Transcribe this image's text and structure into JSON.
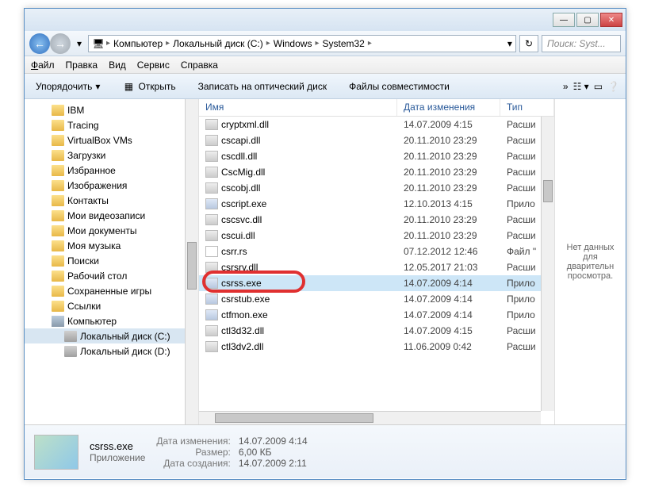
{
  "titlebar": {
    "min": "—",
    "max": "▢",
    "close": "✕"
  },
  "nav": {
    "crumbs": [
      "Компьютер",
      "Локальный диск (C:)",
      "Windows",
      "System32"
    ],
    "search_placeholder": "Поиск: Syst..."
  },
  "menu": {
    "file": "Файл",
    "edit": "Правка",
    "view": "Вид",
    "service": "Сервис",
    "help": "Справка"
  },
  "toolbar": {
    "organize": "Упорядочить",
    "open": "Открыть",
    "burn": "Записать на оптический диск",
    "compat": "Файлы совместимости"
  },
  "tree": {
    "items": [
      {
        "label": "IBM",
        "icon": "folder"
      },
      {
        "label": "Tracing",
        "icon": "folder"
      },
      {
        "label": "VirtualBox VMs",
        "icon": "folder"
      },
      {
        "label": "Загрузки",
        "icon": "folder"
      },
      {
        "label": "Избранное",
        "icon": "folder"
      },
      {
        "label": "Изображения",
        "icon": "folder"
      },
      {
        "label": "Контакты",
        "icon": "folder"
      },
      {
        "label": "Мои видеозаписи",
        "icon": "folder"
      },
      {
        "label": "Мои документы",
        "icon": "folder"
      },
      {
        "label": "Моя музыка",
        "icon": "folder"
      },
      {
        "label": "Поиски",
        "icon": "folder"
      },
      {
        "label": "Рабочий стол",
        "icon": "folder"
      },
      {
        "label": "Сохраненные игры",
        "icon": "folder"
      },
      {
        "label": "Ссылки",
        "icon": "folder"
      },
      {
        "label": "Компьютер",
        "icon": "computer"
      },
      {
        "label": "Локальный диск (C:)",
        "icon": "drive"
      },
      {
        "label": "Локальный диск (D:)",
        "icon": "drive"
      }
    ]
  },
  "columns": {
    "name": "Имя",
    "date": "Дата изменения",
    "type": "Тип"
  },
  "files": [
    {
      "name": "cryptxml.dll",
      "date": "14.07.2009 4:15",
      "type": "Расши",
      "icon": "gear"
    },
    {
      "name": "cscapi.dll",
      "date": "20.11.2010 23:29",
      "type": "Расши",
      "icon": "gear"
    },
    {
      "name": "cscdll.dll",
      "date": "20.11.2010 23:29",
      "type": "Расши",
      "icon": "gear"
    },
    {
      "name": "CscMig.dll",
      "date": "20.11.2010 23:29",
      "type": "Расши",
      "icon": "gear"
    },
    {
      "name": "cscobj.dll",
      "date": "20.11.2010 23:29",
      "type": "Расши",
      "icon": "gear"
    },
    {
      "name": "cscript.exe",
      "date": "12.10.2013 4:15",
      "type": "Прило",
      "icon": "exe"
    },
    {
      "name": "cscsvc.dll",
      "date": "20.11.2010 23:29",
      "type": "Расши",
      "icon": "gear"
    },
    {
      "name": "cscui.dll",
      "date": "20.11.2010 23:29",
      "type": "Расши",
      "icon": "gear"
    },
    {
      "name": "csrr.rs",
      "date": "07.12.2012 12:46",
      "type": "Файл \"",
      "icon": "file"
    },
    {
      "name": "csrsrv.dll",
      "date": "12.05.2017 21:03",
      "type": "Расши",
      "icon": "gear"
    },
    {
      "name": "csrss.exe",
      "date": "14.07.2009 4:14",
      "type": "Прило",
      "icon": "exe",
      "selected": true,
      "highlight": true
    },
    {
      "name": "csrstub.exe",
      "date": "14.07.2009 4:14",
      "type": "Прило",
      "icon": "exe"
    },
    {
      "name": "ctfmon.exe",
      "date": "14.07.2009 4:14",
      "type": "Прило",
      "icon": "exe"
    },
    {
      "name": "ctl3d32.dll",
      "date": "14.07.2009 4:15",
      "type": "Расши",
      "icon": "gear"
    },
    {
      "name": "ctl3dv2.dll",
      "date": "11.06.2009 0:42",
      "type": "Расши",
      "icon": "gear"
    }
  ],
  "preview": {
    "text": "Нет данных для дварительн просмотра."
  },
  "details": {
    "name": "csrss.exe",
    "type": "Приложение",
    "labels": {
      "modified": "Дата изменения:",
      "size": "Размер:",
      "created": "Дата создания:"
    },
    "modified": "14.07.2009 4:14",
    "size": "6,00 КБ",
    "created": "14.07.2009 2:11"
  }
}
